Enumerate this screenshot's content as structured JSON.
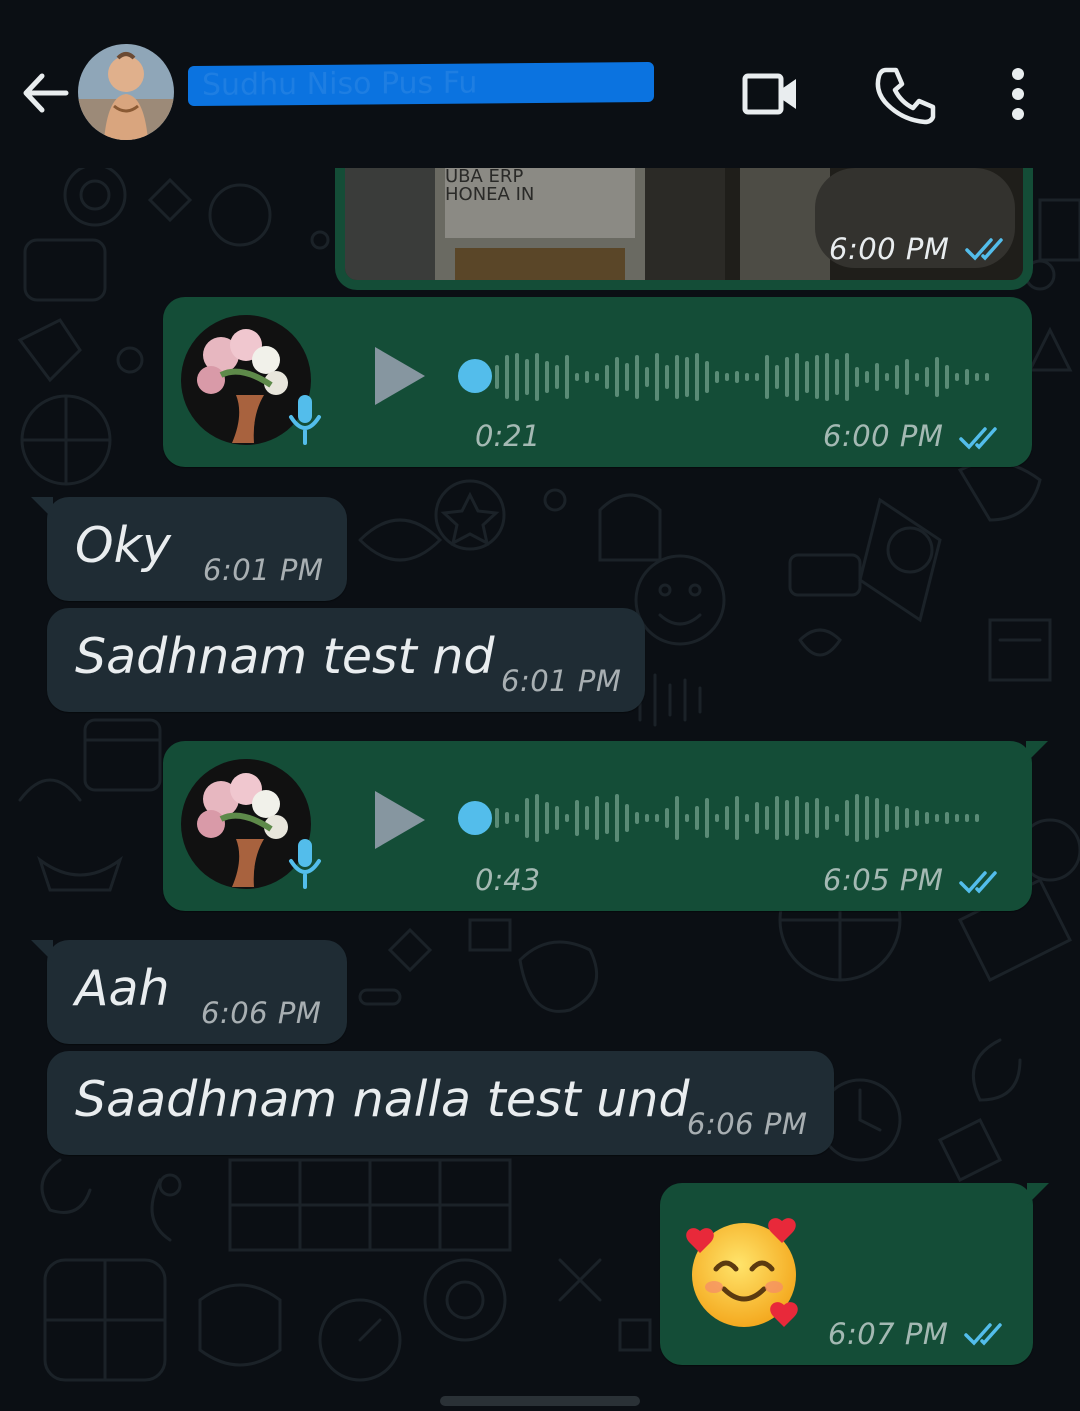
{
  "header": {
    "contact_name_redacted": "Sudhu Niso Pus Fu",
    "icons": [
      "back-arrow-icon",
      "video-call-icon",
      "voice-call-icon",
      "more-vert-icon"
    ]
  },
  "colors": {
    "background": "#0b0f14",
    "outgoing_bubble": "#144d37",
    "incoming_bubble": "#1f2c34",
    "read_ticks": "#53bdeb",
    "redaction": "#0b73e0"
  },
  "messages": [
    {
      "type": "image",
      "direction": "out",
      "time": "6:00 PM",
      "status": "read",
      "image_text": "UBA ERP\nHONEA IN"
    },
    {
      "type": "voice",
      "direction": "out",
      "duration": "0:21",
      "time": "6:00 PM",
      "status": "read",
      "progress": 0
    },
    {
      "type": "text",
      "direction": "in",
      "text": "Oky",
      "time": "6:01 PM"
    },
    {
      "type": "text",
      "direction": "in",
      "text": "Sadhnam test nd",
      "time": "6:01 PM"
    },
    {
      "type": "voice",
      "direction": "out",
      "duration": "0:43",
      "time": "6:05 PM",
      "status": "read",
      "progress": 0
    },
    {
      "type": "text",
      "direction": "in",
      "text": "Aah",
      "time": "6:06 PM"
    },
    {
      "type": "text",
      "direction": "in",
      "text": "Saadhnam nalla test und",
      "time": "6:06 PM"
    },
    {
      "type": "emoji",
      "direction": "out",
      "emoji_name": "smiling-face-with-hearts",
      "time": "6:07 PM",
      "status": "read"
    }
  ]
}
